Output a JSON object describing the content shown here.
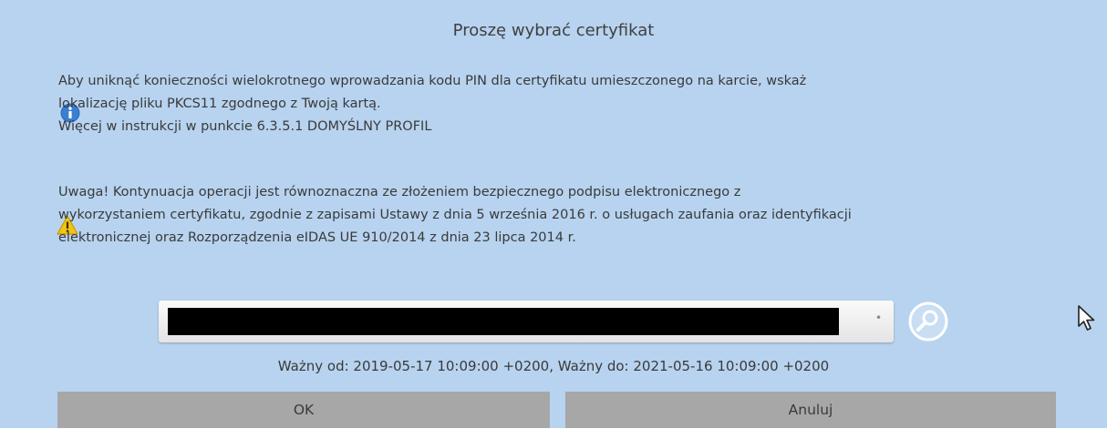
{
  "dialog": {
    "title": "Proszę wybrać certyfikat",
    "info": {
      "icon": "info-icon",
      "lines": [
        "Aby uniknąć konieczności wielokrotnego wprowadzania kodu PIN dla certyfikatu umieszczonego na karcie, wskaż",
        "lokalizację pliku PKCS11 zgodnego z Twoją kartą.",
        "Więcej w instrukcji w punkcie 6.3.5.1 DOMYŚLNY PROFIL"
      ]
    },
    "warning": {
      "icon": "warning-icon",
      "lines": [
        "Uwaga! Kontynuacja operacji jest równoznaczna ze złożeniem bezpiecznego podpisu elektronicznego z",
        "wykorzystaniem certyfikatu, zgodnie z zapisami Ustawy z dnia 5 września 2016 r. o usługach zaufania oraz identyfikacji",
        "elektronicznej oraz  Rozporządzenia eIDAS UE 910/2014 z dnia 23 lipca 2014 r."
      ]
    },
    "certificate_select": {
      "selected_value": ""
    },
    "validity": "Ważny od: 2019-05-17 10:09:00 +0200, Ważny do: 2021-05-16 10:09:00 +0200",
    "buttons": {
      "ok_label": "OK",
      "cancel_label": "Anuluj"
    },
    "colors": {
      "background": "#b7d3ef",
      "button": "#a7a7a7",
      "info_icon": "#2f6fc0",
      "warning_icon": "#f0c419"
    }
  }
}
